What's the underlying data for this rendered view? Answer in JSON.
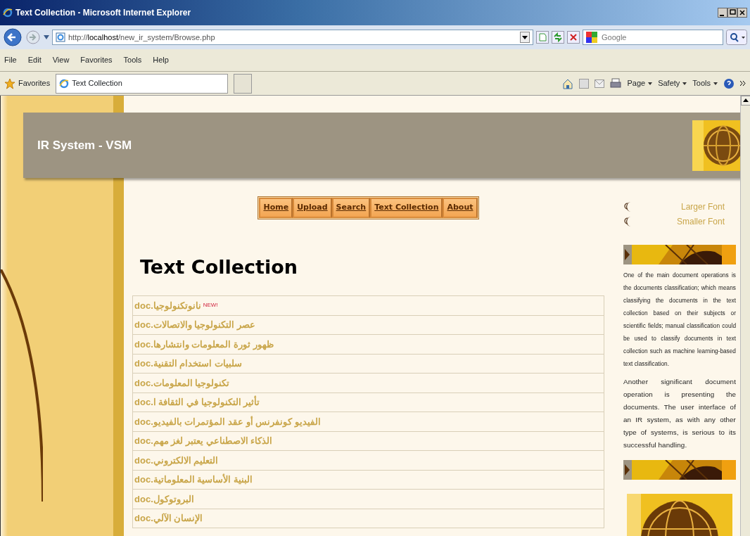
{
  "window": {
    "title": "Text Collection - Microsoft Internet Explorer"
  },
  "address_bar": {
    "url": "http://**localhost**/new_ir_system/Browse.php"
  },
  "search": {
    "placeholder": "Google"
  },
  "menu": [
    "File",
    "Edit",
    "View",
    "Favorites",
    "Tools",
    "Help"
  ],
  "favorites_bar": {
    "label": "Favorites",
    "tab": "Text Collection"
  },
  "command_bar": [
    "Page",
    "Safety",
    "Tools"
  ],
  "page": {
    "site_title": "IR System - VSM",
    "nav": [
      "Home",
      "Upload",
      "Search",
      "Text Collection",
      "About"
    ],
    "heading": "Text Collection",
    "files": [
      {
        "name": "نانوتكنولوجيا.doc",
        "badge": "NEW!"
      },
      {
        "name": "عصر التكنولوجيا والاتصالات.doc"
      },
      {
        "name": "ظهور ثورة المعلومات وانتشارها.doc"
      },
      {
        "name": "سلبيات استخدام التقنية.doc"
      },
      {
        "name": "تكنولوجيا المعلومات.doc"
      },
      {
        "name": "تأثير التكنولوجيا في الثقافة ا.doc"
      },
      {
        "name": "الفيديو كونفرنس أو عقد المؤتمرات بالفيديو.doc"
      },
      {
        "name": "الذكاء الاصطناعي يعتبر لغز مهم.doc"
      },
      {
        "name": "التعليم الالكتروني.doc"
      },
      {
        "name": "البنية الأساسية المعلوماتية.doc"
      },
      {
        "name": "البروتوكول.doc"
      },
      {
        "name": "الإنسان الآلي.doc"
      }
    ],
    "sidebar": {
      "links": [
        "Larger Font",
        "Smaller Font"
      ],
      "paragraphs": [
        "One of the main document operations is the documents classification; which means classifying the documents in the text collection based on their subjects or scientific fields; manual classification could be used to classify documents in text collection such as machine learning-based text classification.",
        "Another significant document operation is presenting the documents. The user interface of an IR system, as with any other type of systems, is serious to its successful handling."
      ]
    }
  }
}
